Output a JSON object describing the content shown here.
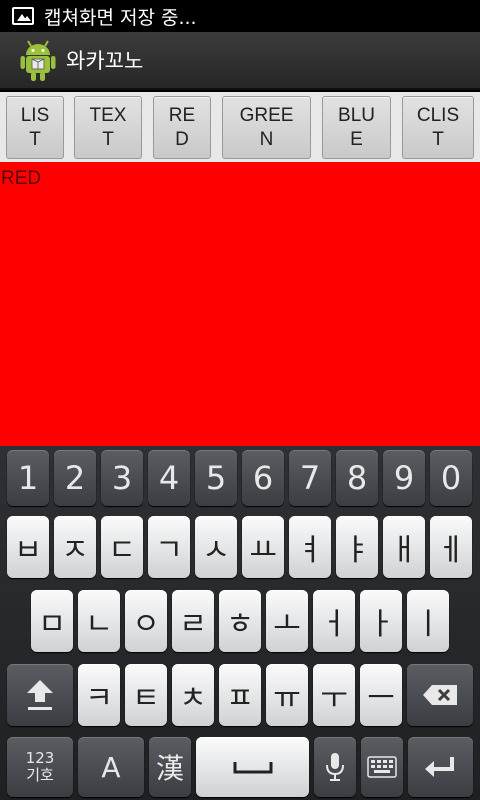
{
  "status_bar": {
    "notification_text": "캡쳐화면 저장 중..."
  },
  "title_bar": {
    "app_title": "와카꼬노"
  },
  "buttons": [
    {
      "label": "LIS\nT"
    },
    {
      "label": "TEX\nT"
    },
    {
      "label": "RE\nD"
    },
    {
      "label": "GREE\nN"
    },
    {
      "label": "BLU\nE"
    },
    {
      "label": "CLIS\nT"
    }
  ],
  "content": {
    "label": "RED",
    "background_color": "#ff0000"
  },
  "keyboard": {
    "row_numbers": [
      "1",
      "2",
      "3",
      "4",
      "5",
      "6",
      "7",
      "8",
      "9",
      "0"
    ],
    "row_1": [
      "ㅂ",
      "ㅈ",
      "ㄷ",
      "ㄱ",
      "ㅅ",
      "ㅛ",
      "ㅕ",
      "ㅑ",
      "ㅐ",
      "ㅔ"
    ],
    "row_2": [
      "ㅁ",
      "ㄴ",
      "ㅇ",
      "ㄹ",
      "ㅎ",
      "ㅗ",
      "ㅓ",
      "ㅏ",
      "ㅣ"
    ],
    "row_3": [
      "ㅋ",
      "ㅌ",
      "ㅊ",
      "ㅍ",
      "ㅠ",
      "ㅜ",
      "ㅡ"
    ],
    "symbols_key": "123\n기호",
    "lang_key": "A",
    "hanja_key": "漢",
    "shift_icon": "shift-arrow-icon",
    "backspace_icon": "backspace-icon",
    "space_icon": "space-bar-icon",
    "mic_icon": "microphone-icon",
    "layout_icon": "keyboard-layout-icon",
    "enter_icon": "enter-arrow-icon"
  }
}
